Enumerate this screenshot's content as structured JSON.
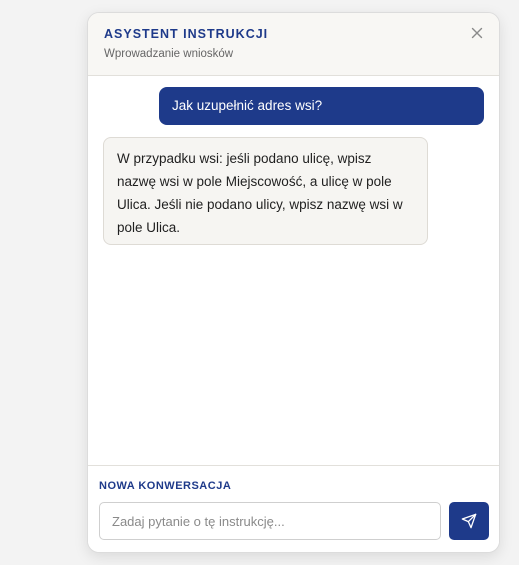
{
  "header": {
    "title": "ASYSTENT INSTRUKCJI",
    "subtitle": "Wprowadzanie wniosków",
    "close_icon": "close-icon"
  },
  "messages": [
    {
      "role": "user",
      "text": "Jak uzupełnić adres wsi?"
    },
    {
      "role": "assistant",
      "text": "W przypadku wsi: jeśli podano ulicę, wpisz nazwę wsi w pole Miejscowość, a ulicę w pole Ulica. Jeśli nie podano ulicy, wpisz nazwę wsi w pole Ulica."
    }
  ],
  "footer": {
    "new_conversation_label": "NOWA KONWERSACJA",
    "input_placeholder": "Zadaj pytanie o tę instrukcję...",
    "input_value": "",
    "send_icon": "send-icon"
  },
  "colors": {
    "accent": "#1e3a8a",
    "header_bg": "#f8f7f4",
    "assistant_bubble_bg": "#f6f5f2"
  }
}
